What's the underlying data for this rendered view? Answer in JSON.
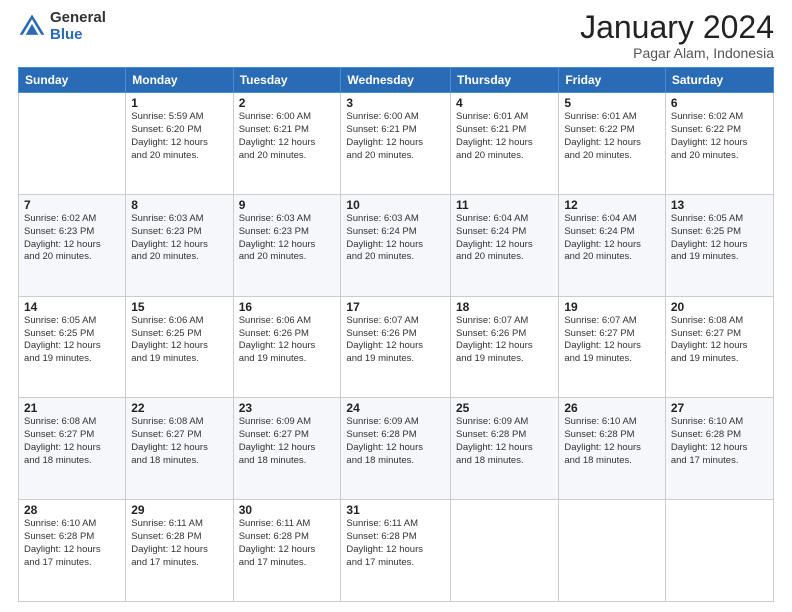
{
  "logo": {
    "general": "General",
    "blue": "Blue"
  },
  "title": {
    "month": "January 2024",
    "location": "Pagar Alam, Indonesia"
  },
  "days_of_week": [
    "Sunday",
    "Monday",
    "Tuesday",
    "Wednesday",
    "Thursday",
    "Friday",
    "Saturday"
  ],
  "weeks": [
    [
      {
        "day": "",
        "sunrise": "",
        "sunset": "",
        "daylight": ""
      },
      {
        "day": "1",
        "sunrise": "Sunrise: 5:59 AM",
        "sunset": "Sunset: 6:20 PM",
        "daylight": "Daylight: 12 hours and 20 minutes."
      },
      {
        "day": "2",
        "sunrise": "Sunrise: 6:00 AM",
        "sunset": "Sunset: 6:21 PM",
        "daylight": "Daylight: 12 hours and 20 minutes."
      },
      {
        "day": "3",
        "sunrise": "Sunrise: 6:00 AM",
        "sunset": "Sunset: 6:21 PM",
        "daylight": "Daylight: 12 hours and 20 minutes."
      },
      {
        "day": "4",
        "sunrise": "Sunrise: 6:01 AM",
        "sunset": "Sunset: 6:21 PM",
        "daylight": "Daylight: 12 hours and 20 minutes."
      },
      {
        "day": "5",
        "sunrise": "Sunrise: 6:01 AM",
        "sunset": "Sunset: 6:22 PM",
        "daylight": "Daylight: 12 hours and 20 minutes."
      },
      {
        "day": "6",
        "sunrise": "Sunrise: 6:02 AM",
        "sunset": "Sunset: 6:22 PM",
        "daylight": "Daylight: 12 hours and 20 minutes."
      }
    ],
    [
      {
        "day": "7",
        "sunrise": "Sunrise: 6:02 AM",
        "sunset": "Sunset: 6:23 PM",
        "daylight": "Daylight: 12 hours and 20 minutes."
      },
      {
        "day": "8",
        "sunrise": "Sunrise: 6:03 AM",
        "sunset": "Sunset: 6:23 PM",
        "daylight": "Daylight: 12 hours and 20 minutes."
      },
      {
        "day": "9",
        "sunrise": "Sunrise: 6:03 AM",
        "sunset": "Sunset: 6:23 PM",
        "daylight": "Daylight: 12 hours and 20 minutes."
      },
      {
        "day": "10",
        "sunrise": "Sunrise: 6:03 AM",
        "sunset": "Sunset: 6:24 PM",
        "daylight": "Daylight: 12 hours and 20 minutes."
      },
      {
        "day": "11",
        "sunrise": "Sunrise: 6:04 AM",
        "sunset": "Sunset: 6:24 PM",
        "daylight": "Daylight: 12 hours and 20 minutes."
      },
      {
        "day": "12",
        "sunrise": "Sunrise: 6:04 AM",
        "sunset": "Sunset: 6:24 PM",
        "daylight": "Daylight: 12 hours and 20 minutes."
      },
      {
        "day": "13",
        "sunrise": "Sunrise: 6:05 AM",
        "sunset": "Sunset: 6:25 PM",
        "daylight": "Daylight: 12 hours and 19 minutes."
      }
    ],
    [
      {
        "day": "14",
        "sunrise": "Sunrise: 6:05 AM",
        "sunset": "Sunset: 6:25 PM",
        "daylight": "Daylight: 12 hours and 19 minutes."
      },
      {
        "day": "15",
        "sunrise": "Sunrise: 6:06 AM",
        "sunset": "Sunset: 6:25 PM",
        "daylight": "Daylight: 12 hours and 19 minutes."
      },
      {
        "day": "16",
        "sunrise": "Sunrise: 6:06 AM",
        "sunset": "Sunset: 6:26 PM",
        "daylight": "Daylight: 12 hours and 19 minutes."
      },
      {
        "day": "17",
        "sunrise": "Sunrise: 6:07 AM",
        "sunset": "Sunset: 6:26 PM",
        "daylight": "Daylight: 12 hours and 19 minutes."
      },
      {
        "day": "18",
        "sunrise": "Sunrise: 6:07 AM",
        "sunset": "Sunset: 6:26 PM",
        "daylight": "Daylight: 12 hours and 19 minutes."
      },
      {
        "day": "19",
        "sunrise": "Sunrise: 6:07 AM",
        "sunset": "Sunset: 6:27 PM",
        "daylight": "Daylight: 12 hours and 19 minutes."
      },
      {
        "day": "20",
        "sunrise": "Sunrise: 6:08 AM",
        "sunset": "Sunset: 6:27 PM",
        "daylight": "Daylight: 12 hours and 19 minutes."
      }
    ],
    [
      {
        "day": "21",
        "sunrise": "Sunrise: 6:08 AM",
        "sunset": "Sunset: 6:27 PM",
        "daylight": "Daylight: 12 hours and 18 minutes."
      },
      {
        "day": "22",
        "sunrise": "Sunrise: 6:08 AM",
        "sunset": "Sunset: 6:27 PM",
        "daylight": "Daylight: 12 hours and 18 minutes."
      },
      {
        "day": "23",
        "sunrise": "Sunrise: 6:09 AM",
        "sunset": "Sunset: 6:27 PM",
        "daylight": "Daylight: 12 hours and 18 minutes."
      },
      {
        "day": "24",
        "sunrise": "Sunrise: 6:09 AM",
        "sunset": "Sunset: 6:28 PM",
        "daylight": "Daylight: 12 hours and 18 minutes."
      },
      {
        "day": "25",
        "sunrise": "Sunrise: 6:09 AM",
        "sunset": "Sunset: 6:28 PM",
        "daylight": "Daylight: 12 hours and 18 minutes."
      },
      {
        "day": "26",
        "sunrise": "Sunrise: 6:10 AM",
        "sunset": "Sunset: 6:28 PM",
        "daylight": "Daylight: 12 hours and 18 minutes."
      },
      {
        "day": "27",
        "sunrise": "Sunrise: 6:10 AM",
        "sunset": "Sunset: 6:28 PM",
        "daylight": "Daylight: 12 hours and 17 minutes."
      }
    ],
    [
      {
        "day": "28",
        "sunrise": "Sunrise: 6:10 AM",
        "sunset": "Sunset: 6:28 PM",
        "daylight": "Daylight: 12 hours and 17 minutes."
      },
      {
        "day": "29",
        "sunrise": "Sunrise: 6:11 AM",
        "sunset": "Sunset: 6:28 PM",
        "daylight": "Daylight: 12 hours and 17 minutes."
      },
      {
        "day": "30",
        "sunrise": "Sunrise: 6:11 AM",
        "sunset": "Sunset: 6:28 PM",
        "daylight": "Daylight: 12 hours and 17 minutes."
      },
      {
        "day": "31",
        "sunrise": "Sunrise: 6:11 AM",
        "sunset": "Sunset: 6:28 PM",
        "daylight": "Daylight: 12 hours and 17 minutes."
      },
      {
        "day": "",
        "sunrise": "",
        "sunset": "",
        "daylight": ""
      },
      {
        "day": "",
        "sunrise": "",
        "sunset": "",
        "daylight": ""
      },
      {
        "day": "",
        "sunrise": "",
        "sunset": "",
        "daylight": ""
      }
    ]
  ]
}
